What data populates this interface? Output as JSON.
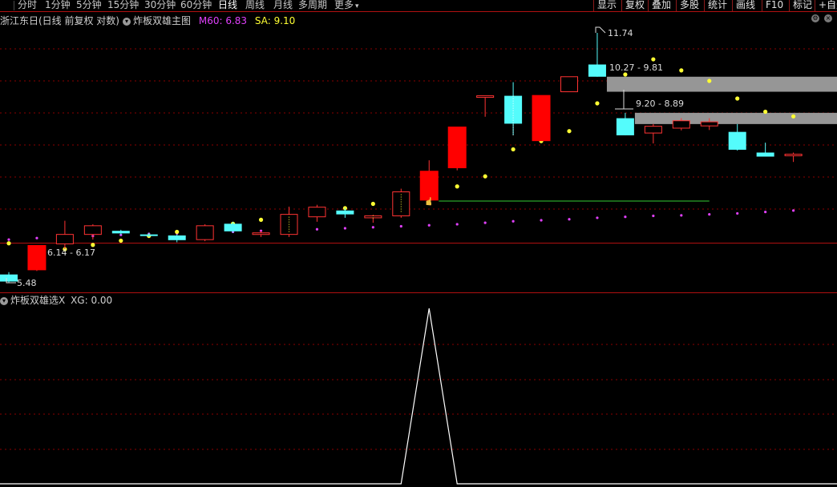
{
  "periods": [
    {
      "label": "分时",
      "active": false
    },
    {
      "label": "1分钟",
      "active": false
    },
    {
      "label": "5分钟",
      "active": false
    },
    {
      "label": "15分钟",
      "active": false
    },
    {
      "label": "30分钟",
      "active": false
    },
    {
      "label": "60分钟",
      "active": false
    },
    {
      "label": "日线",
      "active": true
    },
    {
      "label": "周线",
      "active": false
    },
    {
      "label": "月线",
      "active": false
    },
    {
      "label": "多周期",
      "active": false
    },
    {
      "label": "更多",
      "active": false
    }
  ],
  "right_buttons": [
    "显示",
    "复权",
    "叠加",
    "多股",
    "统计",
    "画线",
    "F10",
    "标记",
    "+自选"
  ],
  "main_title": {
    "stock": "浙江东日(日线 前复权 对数)",
    "indicator": "炸板双雄主图",
    "m60_label": "M60: 6.83",
    "sa_label": "SA: 9.10",
    "m60_color": "#e040fb",
    "sa_color": "#ffff33"
  },
  "sub_title": {
    "indicator": "炸板双雄选X",
    "xg_label": "XG: 0.00"
  },
  "colors": {
    "up": "#ff3333",
    "down": "#54fcfc",
    "limit_up_fill": "#ff0000",
    "grid": "#8b0000",
    "sa_dots": "#ffff33",
    "m60_dots": "#e040fb",
    "zone": "#969696",
    "support_line": "#33cc33",
    "xg_line": "#ffffff"
  },
  "annotations": {
    "high": "11.74",
    "low": "5.48",
    "gap1": "6.14 - 6.17",
    "gap2": "10.27 - 9.81",
    "gap3": "9.20 - 8.89"
  },
  "chart_data": {
    "type": "candlestick",
    "scale": "log",
    "candles": [
      {
        "o": 5.62,
        "h": 5.66,
        "l": 5.48,
        "c": 5.5
      },
      {
        "o": 5.7,
        "h": 6.14,
        "l": 5.68,
        "c": 6.14
      },
      {
        "o": 6.17,
        "h": 6.62,
        "l": 6.06,
        "c": 6.35
      },
      {
        "o": 6.35,
        "h": 6.55,
        "l": 6.25,
        "c": 6.52
      },
      {
        "o": 6.42,
        "h": 6.44,
        "l": 6.34,
        "c": 6.37
      },
      {
        "o": 6.35,
        "h": 6.38,
        "l": 6.3,
        "c": 6.33
      },
      {
        "o": 6.33,
        "h": 6.35,
        "l": 6.2,
        "c": 6.24
      },
      {
        "o": 6.25,
        "h": 6.55,
        "l": 6.22,
        "c": 6.52
      },
      {
        "o": 6.56,
        "h": 6.6,
        "l": 6.38,
        "c": 6.41
      },
      {
        "o": 6.35,
        "h": 6.42,
        "l": 6.3,
        "c": 6.38
      },
      {
        "o": 6.35,
        "h": 6.91,
        "l": 6.3,
        "c": 6.75
      },
      {
        "o": 6.7,
        "h": 6.95,
        "l": 6.6,
        "c": 6.9
      },
      {
        "o": 6.83,
        "h": 6.88,
        "l": 6.68,
        "c": 6.75
      },
      {
        "o": 6.68,
        "h": 6.74,
        "l": 6.58,
        "c": 6.72
      },
      {
        "o": 6.72,
        "h": 7.3,
        "l": 6.68,
        "c": 7.23
      },
      {
        "o": 7.05,
        "h": 7.96,
        "l": 7.03,
        "c": 7.7
      },
      {
        "o": 7.78,
        "h": 8.81,
        "l": 7.72,
        "c": 8.81
      },
      {
        "o": 9.69,
        "h": 9.69,
        "l": 9.09,
        "c": 9.69
      },
      {
        "o": 9.69,
        "h": 10.1,
        "l": 8.59,
        "c": 8.9
      },
      {
        "o": 8.45,
        "h": 9.7,
        "l": 8.45,
        "c": 9.7
      },
      {
        "o": 9.81,
        "h": 10.27,
        "l": 9.81,
        "c": 10.27
      },
      {
        "o": 10.66,
        "h": 11.74,
        "l": 10.27,
        "c": 10.27
      },
      {
        "o": 9.05,
        "h": 9.2,
        "l": 8.59,
        "c": 8.59
      },
      {
        "o": 8.65,
        "h": 8.89,
        "l": 8.38,
        "c": 8.83
      },
      {
        "o": 8.78,
        "h": 9.05,
        "l": 8.72,
        "c": 8.98
      },
      {
        "o": 8.84,
        "h": 9.05,
        "l": 8.73,
        "c": 8.95
      },
      {
        "o": 8.68,
        "h": 8.89,
        "l": 8.2,
        "c": 8.22
      },
      {
        "o": 8.15,
        "h": 8.4,
        "l": 8.05,
        "c": 8.05
      },
      {
        "o": 8.1,
        "h": 8.15,
        "l": 7.92,
        "c": 8.11
      }
    ],
    "sa": [
      6.18,
      5.98,
      6.07,
      6.15,
      6.23,
      6.32,
      6.4,
      6.48,
      6.56,
      6.64,
      6.72,
      6.79,
      6.88,
      6.97,
      7.06,
      7.19,
      7.35,
      7.58,
      8.23,
      8.44,
      8.7,
      9.47,
      10.34,
      10.83,
      10.47,
      10.14,
      9.61,
      9.23,
      9.1
    ],
    "m60": [
      6.25,
      6.28,
      6.3,
      6.32,
      6.34,
      6.36,
      6.37,
      6.39,
      6.4,
      6.42,
      6.44,
      6.45,
      6.47,
      6.49,
      6.51,
      6.53,
      6.55,
      6.58,
      6.61,
      6.63,
      6.65,
      6.68,
      6.7,
      6.72,
      6.73,
      6.75,
      6.77,
      6.8,
      6.83
    ],
    "xg": [
      0,
      0,
      0,
      0,
      0,
      0,
      0,
      0,
      0,
      0,
      0,
      0,
      0,
      0,
      0,
      1,
      0,
      0,
      0,
      0,
      0,
      0,
      0,
      0,
      0,
      0,
      0,
      0,
      0
    ],
    "support_line": {
      "value": 7.03,
      "from": 15,
      "to": 25
    },
    "zones": [
      {
        "from": 21,
        "top": 10.27,
        "bottom": 9.81
      },
      {
        "from": 22,
        "top": 9.2,
        "bottom": 8.89
      }
    ]
  }
}
